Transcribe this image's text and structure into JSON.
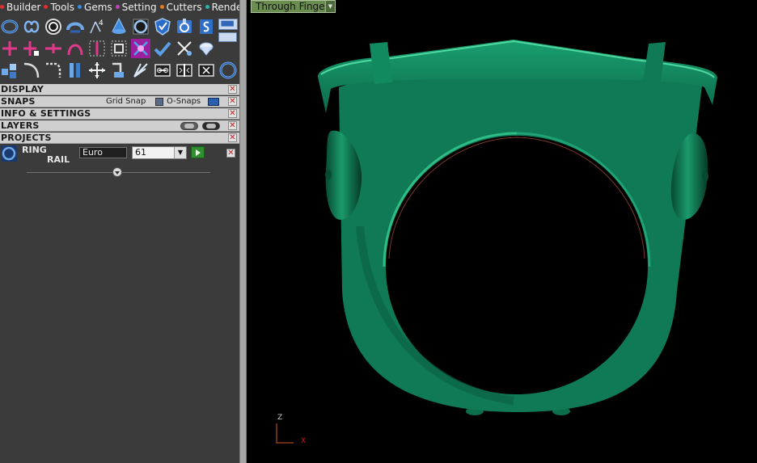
{
  "menu": {
    "items": [
      {
        "label": "Builder",
        "dot": "#e03030"
      },
      {
        "label": "Tools",
        "dot": "#e03030"
      },
      {
        "label": "Gems",
        "dot": "#3a8de0"
      },
      {
        "label": "Setting",
        "dot": "#c040c0"
      },
      {
        "label": "Cutters",
        "dot": "#e07a20"
      },
      {
        "label": "Render",
        "dot": "#30b0b0"
      }
    ]
  },
  "toolbar": {
    "row1": [
      "ring-rail-icon",
      "flower-curve-icon",
      "circle-ring-icon",
      "shank-icon",
      "tool-number-icon",
      "cone-icon",
      "square-ring-icon",
      "shield-icon",
      "gem-seat-icon",
      "blue-s-icon",
      "window-toggle-icon"
    ],
    "row2": [
      "add-cross-icon",
      "add-point-icon",
      "insert-segment-icon",
      "arc-icon",
      "split-icon",
      "frame-icon",
      "pattern-icon",
      "check-icon",
      "scissors-icon",
      "gem-stone-icon"
    ],
    "row3": [
      "cubes-icon",
      "curve-icon",
      "corner-curve-icon",
      "extrude-icon",
      "move-icon",
      "rotate-icon",
      "spark-icon",
      "link-icon",
      "mirror-icon",
      "cut-icon",
      "ring-outline-icon"
    ]
  },
  "panels": {
    "display": "DISPLAY",
    "snaps": "SNAPS",
    "grid_snap": "Grid Snap",
    "o_snaps": "O-Snaps",
    "info": "INFO & SETTINGS",
    "layers": "LAYERS",
    "projects": "PROJECTS"
  },
  "ring_panel": {
    "title1": "RING",
    "title2": "RAIL",
    "standard": "Euro",
    "size": "61"
  },
  "viewport": {
    "view_mode": "Through Finger",
    "axis_z": "Z",
    "axis_x": "X",
    "model_color": "#0f7a55"
  }
}
